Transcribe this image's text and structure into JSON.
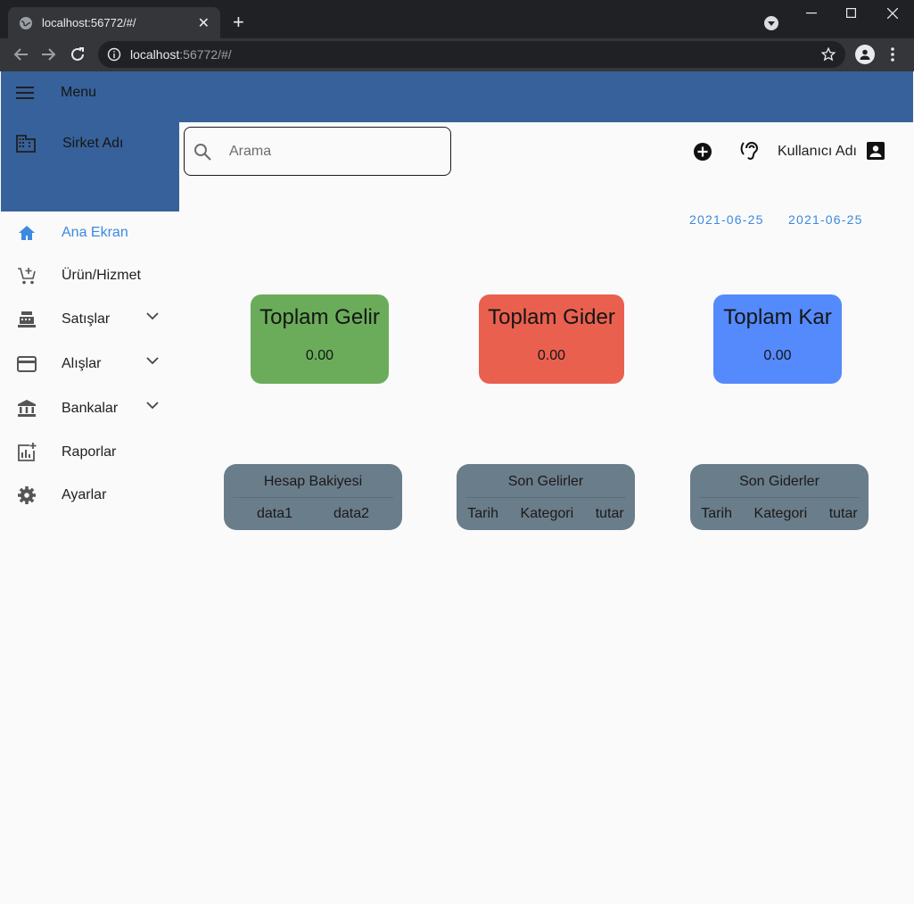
{
  "browser": {
    "tab_title": "localhost:56772/#/",
    "url_host": "localhost",
    "url_rest": ":56772/#/"
  },
  "app": {
    "menu_label": "Menu",
    "company_label": "Sirket Adı",
    "accent": "#37619a"
  },
  "sidebar": {
    "items": [
      {
        "label": "Ana Ekran",
        "icon": "home-icon",
        "active": true
      },
      {
        "label": "Ürün/Hizmet",
        "icon": "cart-add-icon"
      },
      {
        "label": "Satışlar",
        "icon": "cash-register-icon",
        "expandable": true
      },
      {
        "label": "Alışlar",
        "icon": "credit-card-icon",
        "expandable": true
      },
      {
        "label": "Bankalar",
        "icon": "bank-icon",
        "expandable": true
      },
      {
        "label": "Raporlar",
        "icon": "report-icon"
      },
      {
        "label": "Ayarlar",
        "icon": "gear-icon"
      }
    ]
  },
  "header": {
    "search_placeholder": "Arama",
    "user_name": "Kullanıcı Adı"
  },
  "dates": {
    "start": "2021-06-25",
    "end": "2021-06-25"
  },
  "stats": [
    {
      "title": "Toplam Gelir",
      "value": "0.00",
      "color": "#6aac5a"
    },
    {
      "title": "Toplam Gider",
      "value": "0.00",
      "color": "#e9604f"
    },
    {
      "title": "Toplam Kar",
      "value": "0.00",
      "color": "#548afb"
    }
  ],
  "tables": [
    {
      "title": "Hesap Bakiyesi",
      "columns": [
        "data1",
        "data2"
      ]
    },
    {
      "title": "Son Gelirler",
      "columns": [
        "Tarih",
        "Kategori",
        "tutar"
      ]
    },
    {
      "title": "Son Giderler",
      "columns": [
        "Tarih",
        "Kategori",
        "tutar"
      ]
    }
  ]
}
